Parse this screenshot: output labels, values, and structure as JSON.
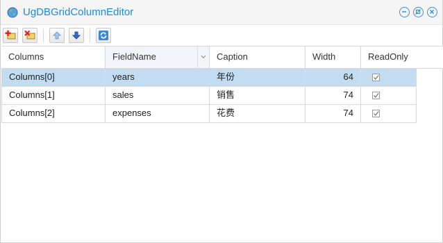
{
  "window": {
    "title": "UgDBGridColumnEditor"
  },
  "title_tools": [
    {
      "name": "minimize-button",
      "icon": "minus-icon"
    },
    {
      "name": "restore-button",
      "icon": "restore-icon"
    },
    {
      "name": "close-button",
      "icon": "close-icon"
    }
  ],
  "toolbar": [
    {
      "name": "add-column-button",
      "icon": "add-icon"
    },
    {
      "name": "delete-column-button",
      "icon": "delete-icon"
    },
    {
      "name": "move-up-button",
      "icon": "arrow-up-icon"
    },
    {
      "name": "move-down-button",
      "icon": "arrow-down-icon"
    },
    {
      "name": "refresh-button",
      "icon": "refresh-icon"
    }
  ],
  "grid": {
    "headers": [
      "Columns",
      "FieldName",
      "Caption",
      "Width",
      "ReadOnly"
    ],
    "rows": [
      {
        "column": "Columns[0]",
        "fieldname": "years",
        "caption": "年份",
        "width": "64",
        "readonly": true,
        "selected": true
      },
      {
        "column": "Columns[1]",
        "fieldname": "sales",
        "caption": "销售",
        "width": "74",
        "readonly": true,
        "selected": false
      },
      {
        "column": "Columns[2]",
        "fieldname": "expenses",
        "caption": "花费",
        "width": "74",
        "readonly": true,
        "selected": false
      }
    ]
  },
  "colors": {
    "accent": "#1e88e5",
    "selected_row": "#c2dcf2"
  }
}
